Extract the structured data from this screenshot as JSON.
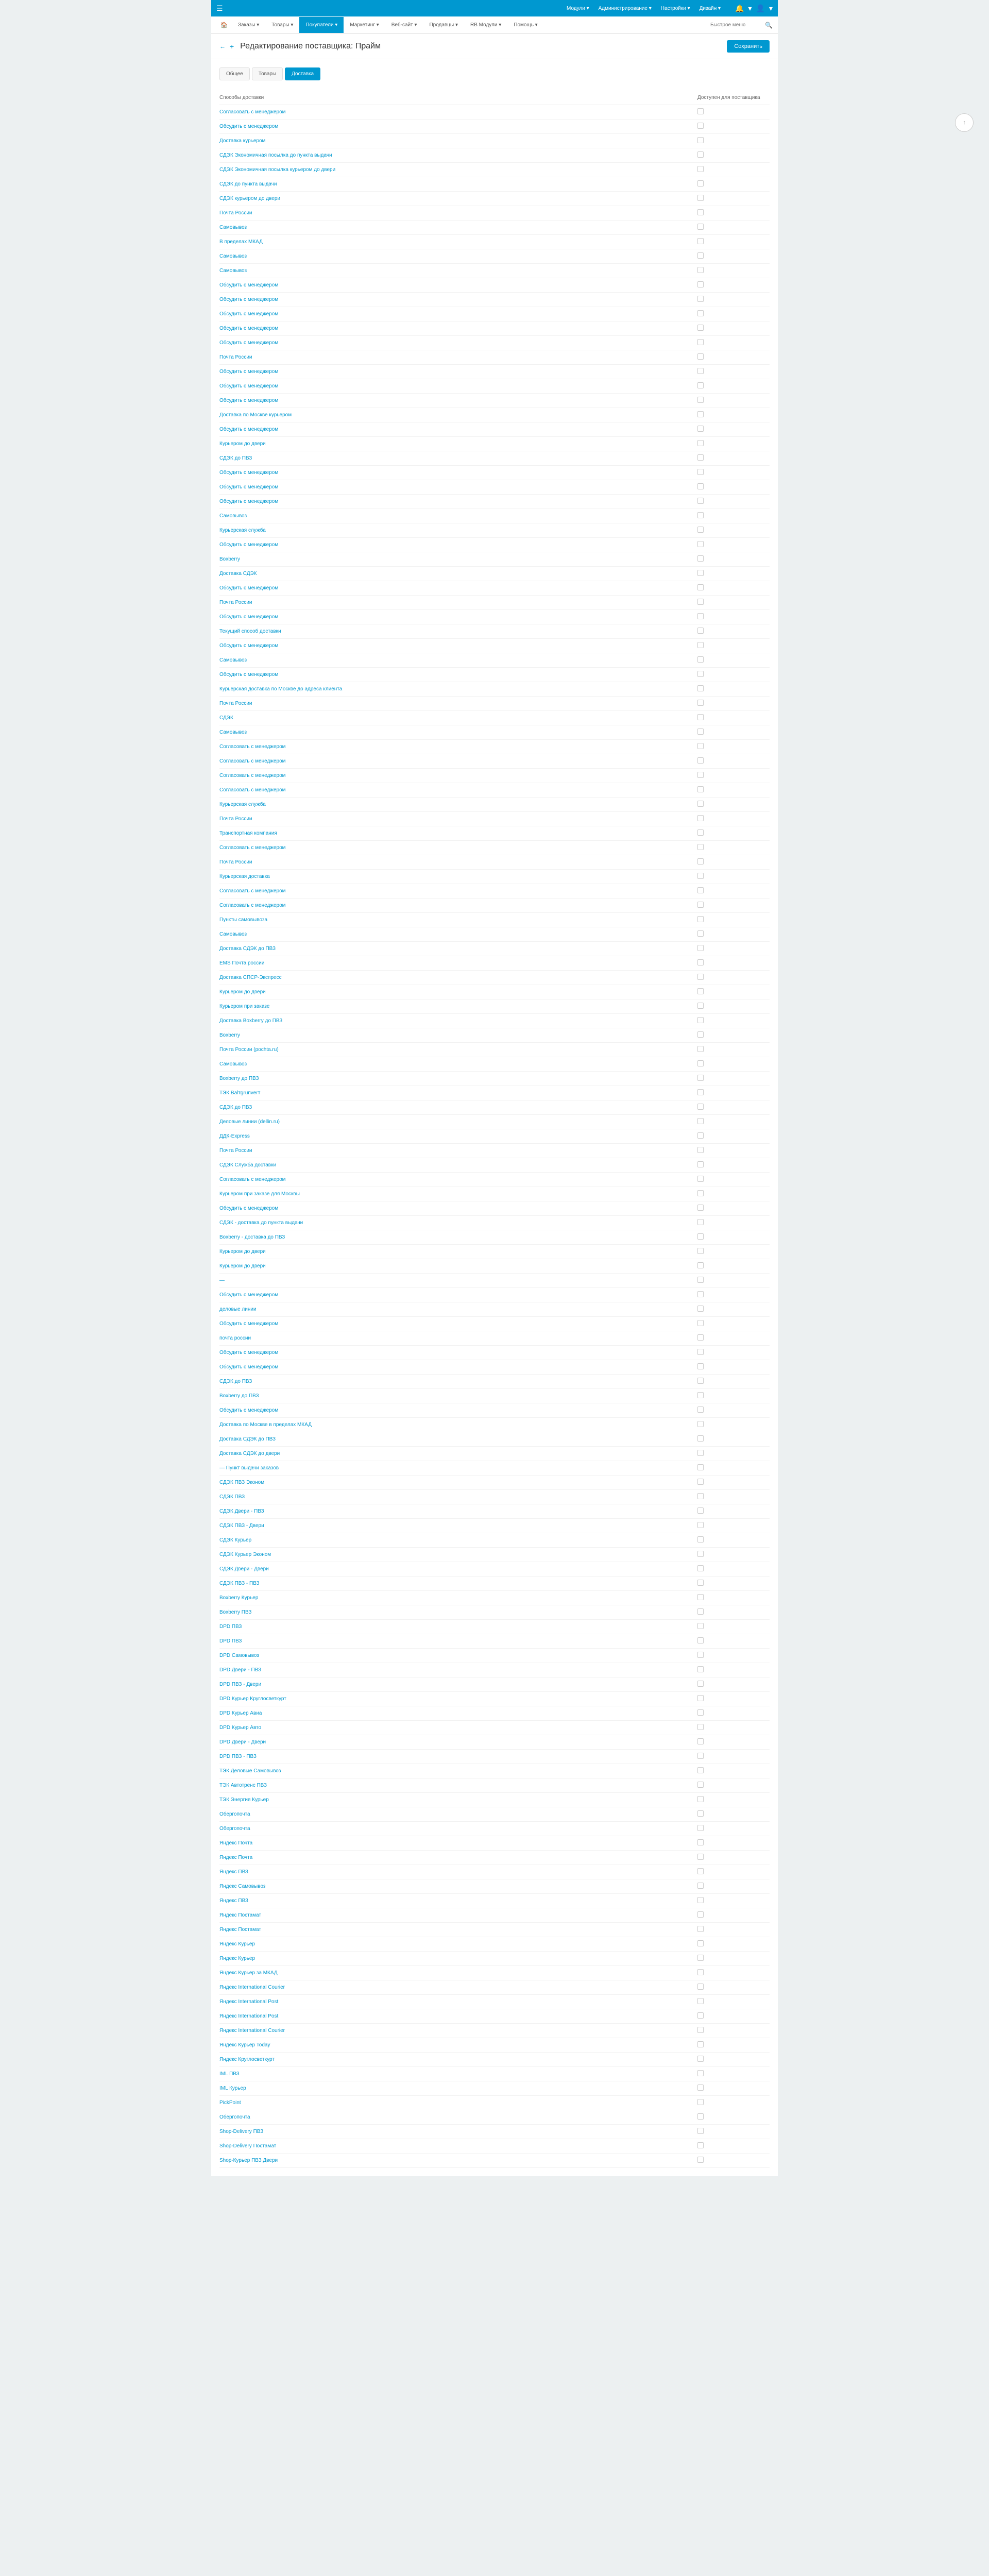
{
  "topbar": {
    "menu": [
      "Модули ▾",
      "Администрирование ▾",
      "Настройки ▾",
      "Дизайн ▾"
    ]
  },
  "nav": {
    "items": [
      "Заказы ▾",
      "Товары ▾",
      "Покупатели ▾",
      "Маркетинг ▾",
      "Веб-сайт ▾",
      "Продавцы ▾",
      "RB Модули ▾",
      "Помощь ▾"
    ],
    "search_placeholder": "Быстрое меню"
  },
  "page": {
    "title": "Редактирование поставщика: Прайм",
    "save": "Сохранить"
  },
  "tabs": [
    "Общее",
    "Товары",
    "Доставка"
  ],
  "table": {
    "col_name": "Способы доставки",
    "col_avail": "Доступен для поставщика"
  },
  "rows": [
    "Согласовать с менеджером",
    "Обсудить с менеджером",
    "Доставка курьером",
    "СДЭК Экономичная посылка до пункта выдачи",
    "СДЭК Экономичная посылка курьером до двери",
    "СДЭК до пункта выдачи",
    "СДЭК курьером до двери",
    "Почта России",
    "Самовывоз",
    "В пределах МКАД",
    "Самовывоз",
    "Самовывоз",
    "Обсудить с менеджером",
    "Обсудить с менеджером",
    "Обсудить с менеджером",
    "Обсудить с менеджером",
    "Обсудить с менеджером",
    "Почта России",
    "Обсудить с менеджером",
    "Обсудить с менеджером",
    "Обсудить с менеджером",
    "Доставка по Москве курьером",
    "Обсудить с менеджером",
    "Курьером до двери",
    "СДЭК до ПВЗ",
    "Обсудить с менеджером",
    "Обсудить с менеджером",
    "Обсудить с менеджером",
    "Самовывоз",
    "Курьерская служба",
    "Обсудить с менеджером",
    "Boxberry",
    "Доставка СДЭК",
    "Обсудить с менеджером",
    "Почта России",
    "Обсудить с менеджером",
    "Текущий способ доставки",
    "Обсудить с менеджером",
    "Самовывоз",
    "Обсудить с менеджером",
    "Курьерская доставка по Москве до адреса клиента",
    "Почта России",
    "СДЭК",
    "Самовывоз",
    "Согласовать с менеджером",
    "Согласовать с менеджером",
    "Согласовать с менеджером",
    "Согласовать с менеджером",
    "Курьерская служба",
    "Почта России",
    "Транспортная компания",
    "Согласовать с менеджером",
    "Почта России",
    "Курьерская доставка",
    "Согласовать с менеджером",
    "Согласовать с менеджером",
    "Пункты самовывоза",
    "Самовывоз",
    "Доставка СДЭК до ПВЗ",
    "EMS Почта россии",
    "Доставка СПСР-Экспресс",
    "Курьером до двери",
    "Курьером при заказе",
    "Доставка Boxberry до ПВЗ",
    "Boxberry",
    "Почта России (pochta.ru)",
    "Самовывоз",
    "Boxberry до ПВЗ",
    "ТЭК Balтgruпverт",
    "СДЭК до ПВЗ",
    "Деловые линии (dellin.ru)",
    "ДДК-Express",
    "Почта России",
    "СДЭК Служба доставки",
    "Согласовать с менеджером",
    "Курьером при заказе для Москвы",
    "Обсудить с менеджером",
    "СДЭК - доставка до пункта выдачи",
    "Boxberry - доставка до ПВЗ",
    "Курьером до двери",
    "Курьером до двери",
    "—",
    "Обсудить с менеджером",
    "деловые линии",
    "Обсудить с менеджером",
    "почта россии",
    "Обсудить с менеджером",
    "Обсудить с менеджером",
    "СДЭК до ПВЗ",
    "Boxberry до ПВЗ",
    "Обсудить с менеджером",
    "Доставка по Москве в пределах МКАД",
    "Доставка СДЭК до ПВЗ",
    "Доставка СДЭК до двери",
    "— Пункт выдачи заказов",
    "СДЭК ПВЗ Эконом",
    "СДЭК ПВЗ",
    "СДЭК Двери - ПВЗ",
    "СДЭК ПВЗ - Двери",
    "СДЭК Курьер",
    "СДЭК Курьер Эконом",
    "СДЭК Двери - Двери",
    "СДЭК ПВЗ - ПВЗ",
    "Boxberry Курьер",
    "Boxberry ПВЗ",
    "DPD ПВЗ",
    "DPD ПВЗ",
    "DPD Самовывоз",
    "DPD Двери - ПВЗ",
    "DPD ПВЗ - Двери",
    "DPD Курьер Круглосветкурт",
    "DPD Курьер Авиа",
    "DPD Курьер Авто",
    "DPD Двери - Двери",
    "DPD ПВЗ - ПВЗ",
    "ТЭК Деловые Самовывоз",
    "ТЭК Автотренс ПВЗ",
    "ТЭК Энергия Курьер",
    "Обергопочта",
    "Обергопочта",
    "Яндекс Почта",
    "Яндекс Почта",
    "Яндекс ПВЗ",
    "Яндекс Самовывоз",
    "Яндекс ПВЗ",
    "Яндекс Постамат",
    "Яндекс Постамат",
    "Яндекс Курьер",
    "Яндекс Курьер",
    "Яндекс Курьер за МКАД",
    "Яндекс International Courier",
    "Яндекс International Post",
    "Яндекс International Post",
    "Яндекс International Courier",
    "Яндекс Курьер Today",
    "Яндекс Круглосветкурт",
    "IML ПВЗ",
    "IML Курьер",
    "PickPoint",
    "Обергопочта",
    "Shop-Delivery ПВЗ",
    "Shop-Delivery Постамат",
    "Shop-Курьер ПВЗ Двери"
  ]
}
